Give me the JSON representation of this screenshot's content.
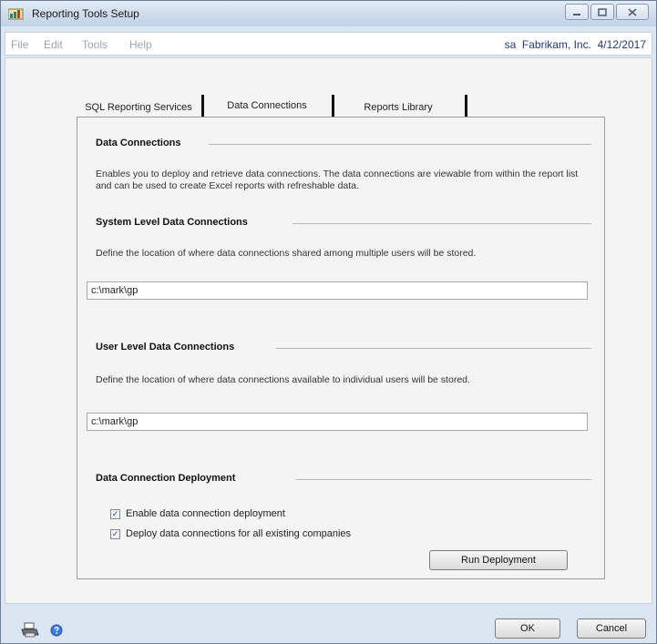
{
  "window": {
    "title": "Reporting Tools Setup",
    "controls": [
      "minimize",
      "maximize",
      "close"
    ]
  },
  "menubar": {
    "items": [
      {
        "label": "File"
      },
      {
        "label": "Edit"
      },
      {
        "label": "Tools"
      },
      {
        "label": "Help"
      }
    ],
    "session": "sa  Fabrikam, Inc.  4/12/2017"
  },
  "tabs": [
    {
      "label": "SQL Reporting Services",
      "active": false
    },
    {
      "label": "Data Connections",
      "active": true
    },
    {
      "label": "Reports Library",
      "active": false
    }
  ],
  "data_connections": {
    "heading": "Data Connections",
    "description": "Enables you to deploy and retrieve data connections. The data connections are viewable from within the report list and can be used to create Excel reports with refreshable data."
  },
  "system_level": {
    "heading": "System Level Data Connections",
    "description": "Define the location of where data connections shared among multiple users will be stored.",
    "path": "c:\\mark\\gp"
  },
  "user_level": {
    "heading": "User Level Data Connections",
    "description": "Define the location of where data connections available to individual users will be stored.",
    "path": "c:\\mark\\gp"
  },
  "deployment": {
    "heading": "Data Connection Deployment",
    "options": [
      {
        "label": "Enable data connection deployment",
        "checked": true
      },
      {
        "label": "Deploy data connections for all existing companies",
        "checked": true
      }
    ],
    "run_button": "Run Deployment"
  },
  "footer": {
    "ok_button": "OK",
    "cancel_button": "Cancel",
    "icons": [
      "printer-icon",
      "help-icon"
    ]
  },
  "colors": {
    "chrome": "#dce6f3",
    "session_text": "#1d3b78",
    "menu_disabled": "#9aa3ad"
  }
}
